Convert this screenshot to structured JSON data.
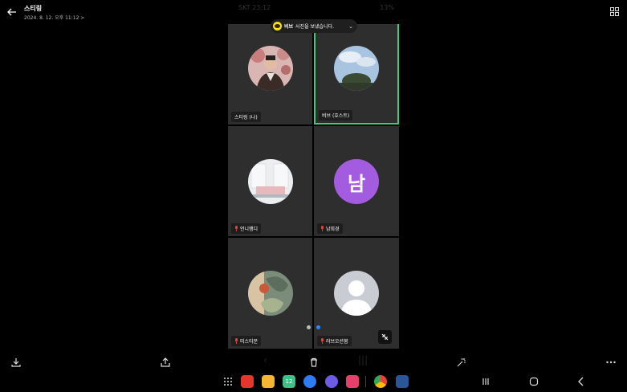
{
  "header": {
    "title": "스티링",
    "date": "2024. 8. 12. 오후 11:12 >"
  },
  "phone": {
    "status_carrier": "SKT 23:12",
    "status_right": "13%"
  },
  "toast": {
    "sender": "비브",
    "message": "사진을 보냈습니다."
  },
  "participants": [
    {
      "name": "스티링 (나)",
      "muted": false
    },
    {
      "name": "비브 (호스트)",
      "muted": false
    },
    {
      "name": "언니햄디",
      "muted": true
    },
    {
      "name": "남희경",
      "muted": true,
      "avatar_text": "남"
    },
    {
      "name": "미스티문",
      "muted": true
    },
    {
      "name": "러브오션붐",
      "muted": true
    }
  ],
  "colors": {
    "active_speaker": "#34d178",
    "avatar_purple": "#a35be0",
    "mic_muted": "#e0443a"
  }
}
